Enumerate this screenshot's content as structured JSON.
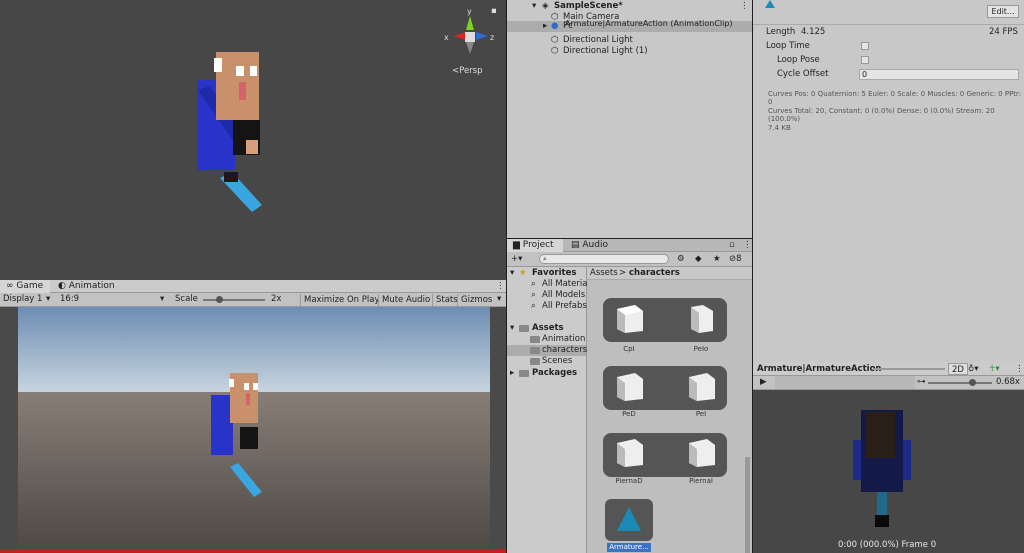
{
  "scene": {
    "persp_label": "<Persp",
    "gizmo_y": "y",
    "gizmo_x": "x",
    "gizmo_z": "z"
  },
  "game": {
    "tabs": [
      {
        "label": "Game"
      },
      {
        "label": "Animation"
      }
    ],
    "display": "Display 1",
    "aspect": "16:9",
    "scale_label": "Scale",
    "scale_value": "2x",
    "scale_fraction": 0.25,
    "buttons": [
      "Maximize On Play",
      "Mute Audio",
      "Stats",
      "Gizmos"
    ]
  },
  "hierarchy": {
    "scene_name": "SampleScene*",
    "items": [
      "Main Camera",
      "Armature|ArmatureAction (AnimationClip)",
      "Directional Light",
      "Directional Light (1)"
    ],
    "obscured_item": "Pc"
  },
  "project": {
    "tabs": [
      "Project",
      "Audio Mixer"
    ],
    "hidden_count": "8",
    "favorites_label": "Favorites",
    "favorites": [
      "All Materia",
      "All Models",
      "All Prefabs"
    ],
    "assets_label": "Assets",
    "asset_folders": [
      "Animation",
      "characters",
      "Scenes"
    ],
    "packages_label": "Packages",
    "breadcrumb_root": "Assets",
    "breadcrumb_sep": ">",
    "breadcrumb_current": "characters",
    "grid_items": [
      "CpI",
      "PeIo",
      "PeD",
      "PeI",
      "PiernaD",
      "PiernaI",
      "Armature..."
    ]
  },
  "inspector": {
    "edit_button": "Edit...",
    "length_label": "Length",
    "length_value": "4.125",
    "fps": "24 FPS",
    "loop_time": "Loop Time",
    "loop_pose": "Loop Pose",
    "cycle_offset": "Cycle Offset",
    "cycle_offset_value": "0",
    "curves_line1": "Curves Pos: 0 Quaternion: 5 Euler: 0 Scale: 0 Muscles: 0 Generic: 0 PPtr:",
    "curves_line2": "0",
    "curves_line3": "Curves Total: 20, Constant: 0 (0.0%) Dense: 0 (0.0%) Stream: 20",
    "curves_line4": "(100.0%)",
    "size": "7.4 KB"
  },
  "preview": {
    "title": "Armature|ArmatureAction",
    "mode_2d": "2D",
    "speed": "0.68x",
    "speed_fraction": 0.68,
    "time": "0:00 (000.0%) Frame 0"
  },
  "colors": {
    "accent_blue": "#2f6bd1",
    "selection": "#3a72c4",
    "timeline_red": "#c02020"
  }
}
